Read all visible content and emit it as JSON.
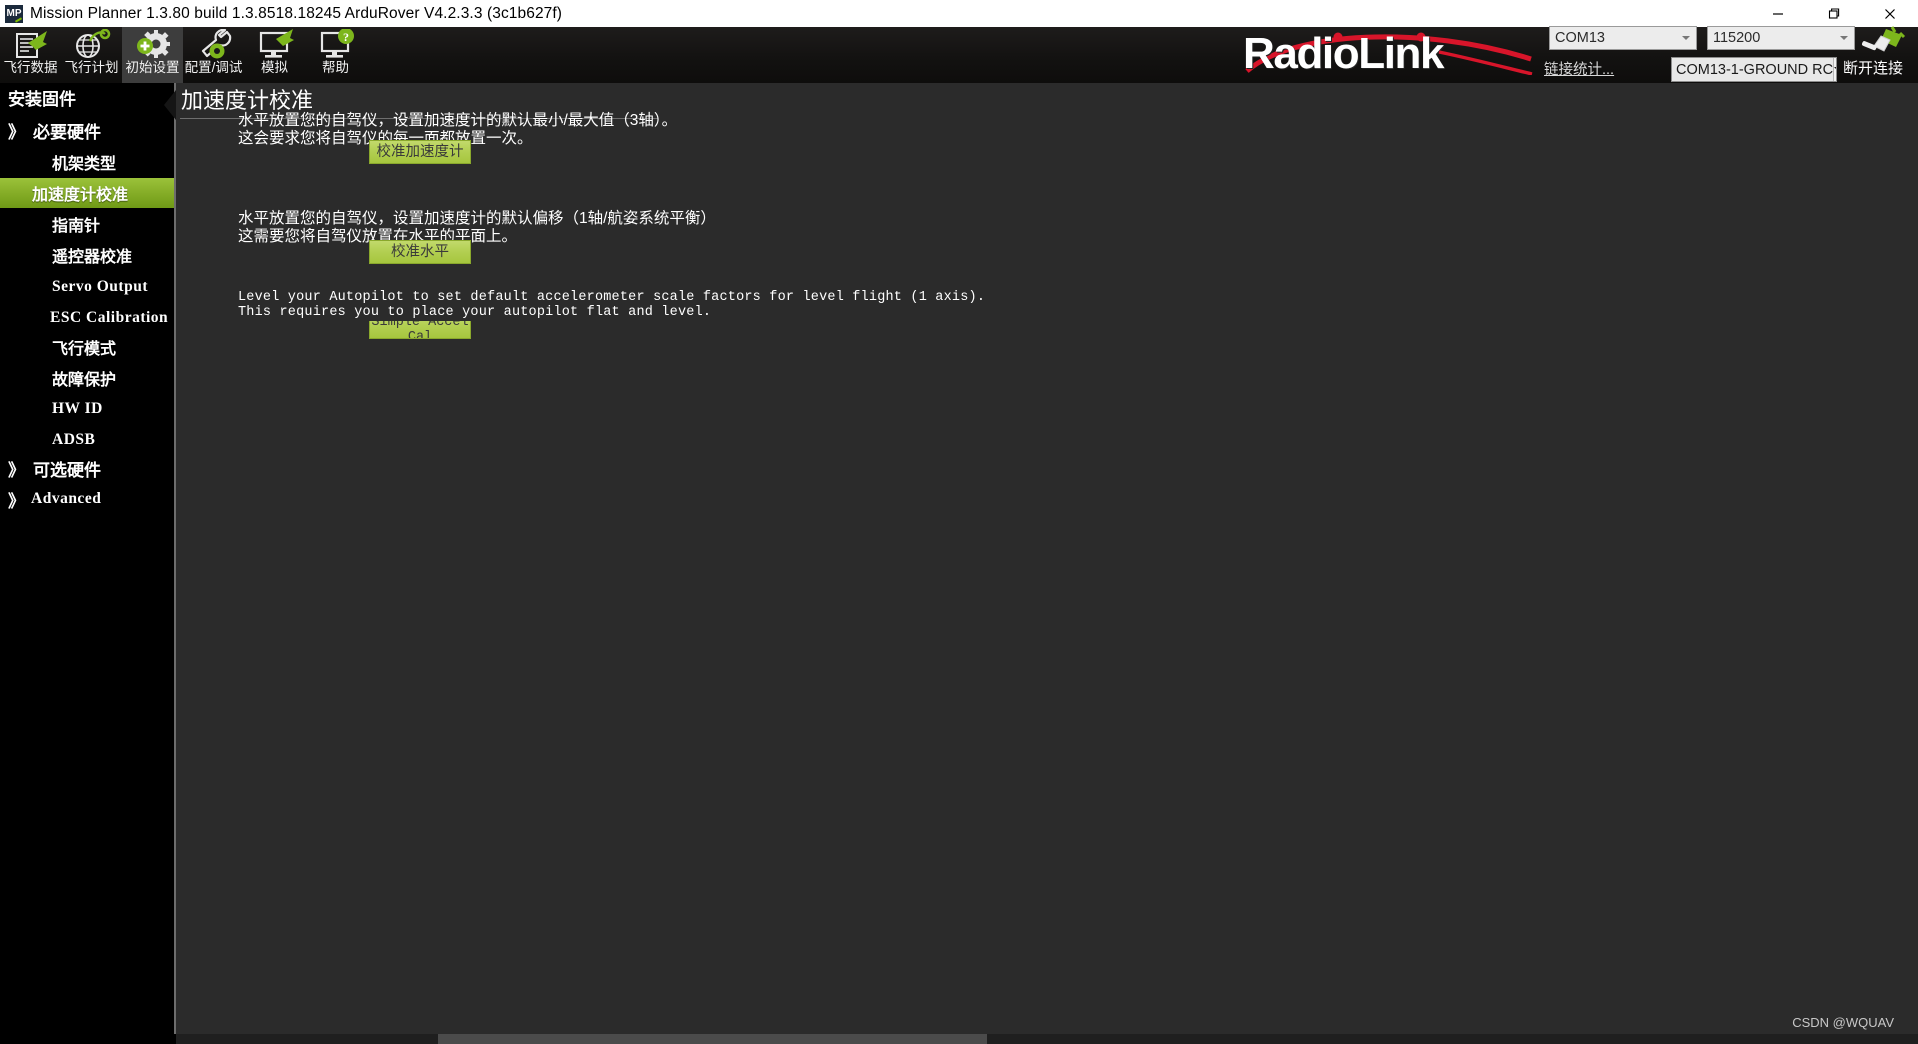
{
  "window": {
    "title": "Mission Planner 1.3.80 build 1.3.8518.18245 ArduRover V4.2.3.3 (3c1b627f)",
    "app_icon_text": "MP",
    "minimize_label": "minimize",
    "maximize_label": "maximize",
    "close_label": "close"
  },
  "toolbar": {
    "items": [
      {
        "label": "飞行数据",
        "icon": "flight-data-icon",
        "active": false
      },
      {
        "label": "飞行计划",
        "icon": "flight-plan-icon",
        "active": false
      },
      {
        "label": "初始设置",
        "icon": "initial-setup-icon",
        "active": true
      },
      {
        "label": "配置/调试",
        "icon": "config-tuning-icon",
        "active": false
      },
      {
        "label": "模拟",
        "icon": "simulation-icon",
        "active": false
      },
      {
        "label": "帮助",
        "icon": "help-icon",
        "active": false
      }
    ]
  },
  "branding": {
    "logo_text": "RadioLink",
    "logo_accent": "#d8152a"
  },
  "connection": {
    "port_value": "COM13",
    "baud_value": "115200",
    "link_stats_label": "链接统计...",
    "device_value": "COM13-1-GROUND RC",
    "disconnect_label": "断开连接",
    "plug_icon": "plug-connected-icon"
  },
  "sidebar": {
    "items": [
      {
        "label": "安装固件",
        "kind": "head",
        "selected": false
      },
      {
        "label": "必要硬件",
        "kind": "group",
        "chevron": "》",
        "selected": false
      },
      {
        "label": "机架类型",
        "kind": "sub",
        "selected": false
      },
      {
        "label": "加速度计校准",
        "kind": "sub",
        "selected": true
      },
      {
        "label": "指南针",
        "kind": "sub",
        "selected": false
      },
      {
        "label": "遥控器校准",
        "kind": "sub",
        "selected": false
      },
      {
        "label": "Servo Output",
        "kind": "mono",
        "selected": false
      },
      {
        "label": "ESC Calibration",
        "kind": "mono",
        "selected": false
      },
      {
        "label": "飞行模式",
        "kind": "sub",
        "selected": false
      },
      {
        "label": "故障保护",
        "kind": "sub",
        "selected": false
      },
      {
        "label": "HW ID",
        "kind": "mono",
        "selected": false
      },
      {
        "label": "ADSB",
        "kind": "mono",
        "selected": false
      },
      {
        "label": "可选硬件",
        "kind": "group",
        "chevron": "》",
        "selected": false
      },
      {
        "label": "Advanced",
        "kind": "group-mono",
        "chevron": "》",
        "selected": false
      }
    ]
  },
  "main": {
    "page_title": "加速度计校准",
    "sections": [
      {
        "name": "accel-calibration",
        "line1": "水平放置您的自驾仪，设置加速度计的默认最小/最大值（3轴）。",
        "line2": "这会要求您将自驾仪的每一面都放置一次。",
        "button_label": "校准加速度计"
      },
      {
        "name": "level-calibration",
        "line1": "水平放置您的自驾仪，设置加速度计的默认偏移（1轴/航姿系统平衡）",
        "line2": "这需要您将自驾仪放置在水平的平面上。",
        "button_label": "校准水平"
      },
      {
        "name": "simple-accel-calibration",
        "line1": "Level your Autopilot to set default accelerometer scale factors for level flight (1 axis).",
        "line2": "This requires you to place your autopilot flat and level.",
        "button_label_top": "Simple Accel",
        "button_label_bottom": "Cal"
      }
    ]
  },
  "footer": {
    "watermark": "CSDN @WQUAV"
  }
}
